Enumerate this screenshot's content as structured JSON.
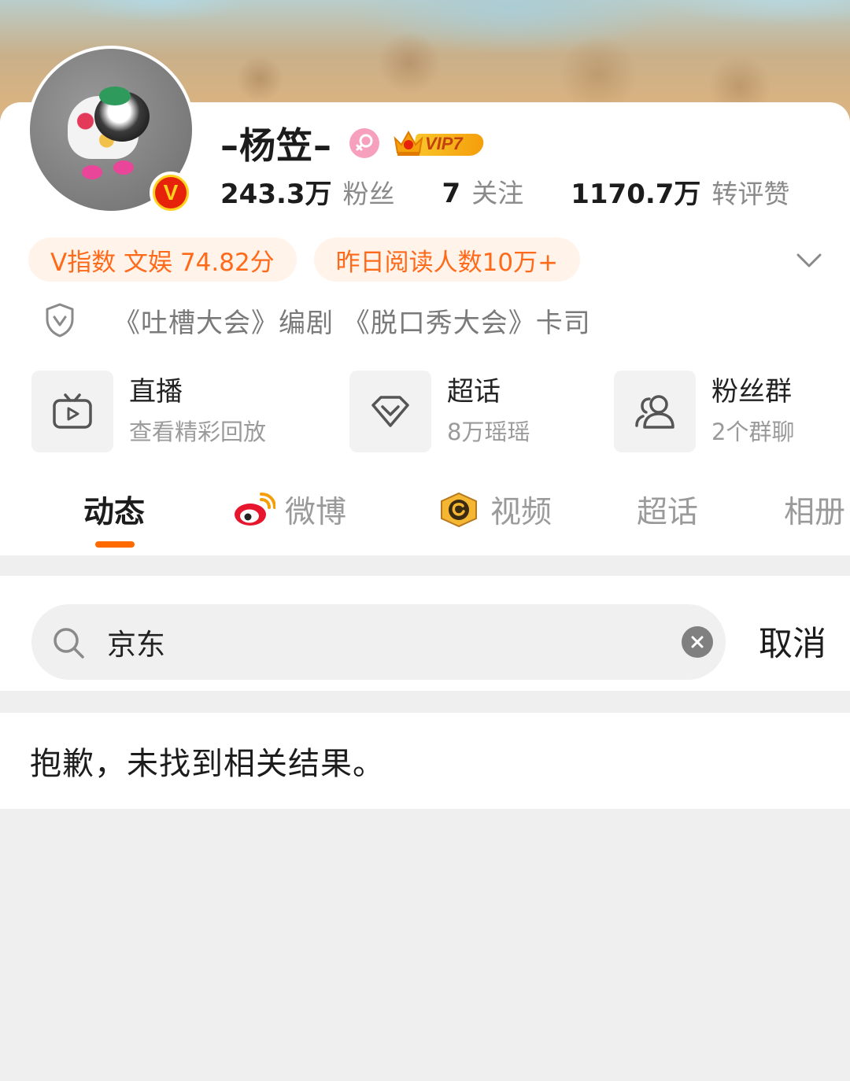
{
  "profile": {
    "nickname": "–杨笠–",
    "vip_label": "VIP7",
    "verified_mark": "V",
    "stats": [
      {
        "value": "243.3万",
        "label": "粉丝"
      },
      {
        "value": "7",
        "label": "关注"
      },
      {
        "value": "1170.7万",
        "label": "转评赞"
      }
    ],
    "tags": [
      "V指数 文娱 74.82分",
      "昨日阅读人数10万+"
    ],
    "verification": "《吐槽大会》编剧 《脱口秀大会》卡司"
  },
  "features": [
    {
      "title": "直播",
      "subtitle": "查看精彩回放",
      "icon": "tv-play-icon"
    },
    {
      "title": "超话",
      "subtitle": "8万瑶瑶",
      "icon": "diamond-icon"
    },
    {
      "title": "粉丝群",
      "subtitle": "2个群聊",
      "icon": "group-icon"
    }
  ],
  "tabs": [
    {
      "label": "动态",
      "active": true
    },
    {
      "label": "微博",
      "icon": "weibo-icon"
    },
    {
      "label": "视频",
      "icon": "video-badge-icon"
    },
    {
      "label": "超话"
    },
    {
      "label": "相册"
    }
  ],
  "search": {
    "query": "京东",
    "cancel_label": "取消"
  },
  "results": {
    "empty_message": "抱歉，未找到相关结果。"
  },
  "colors": {
    "accent": "#ff6a00",
    "tag_bg": "#fff3ea",
    "tag_text": "#ff6a1a",
    "page_bg": "#efefef"
  }
}
